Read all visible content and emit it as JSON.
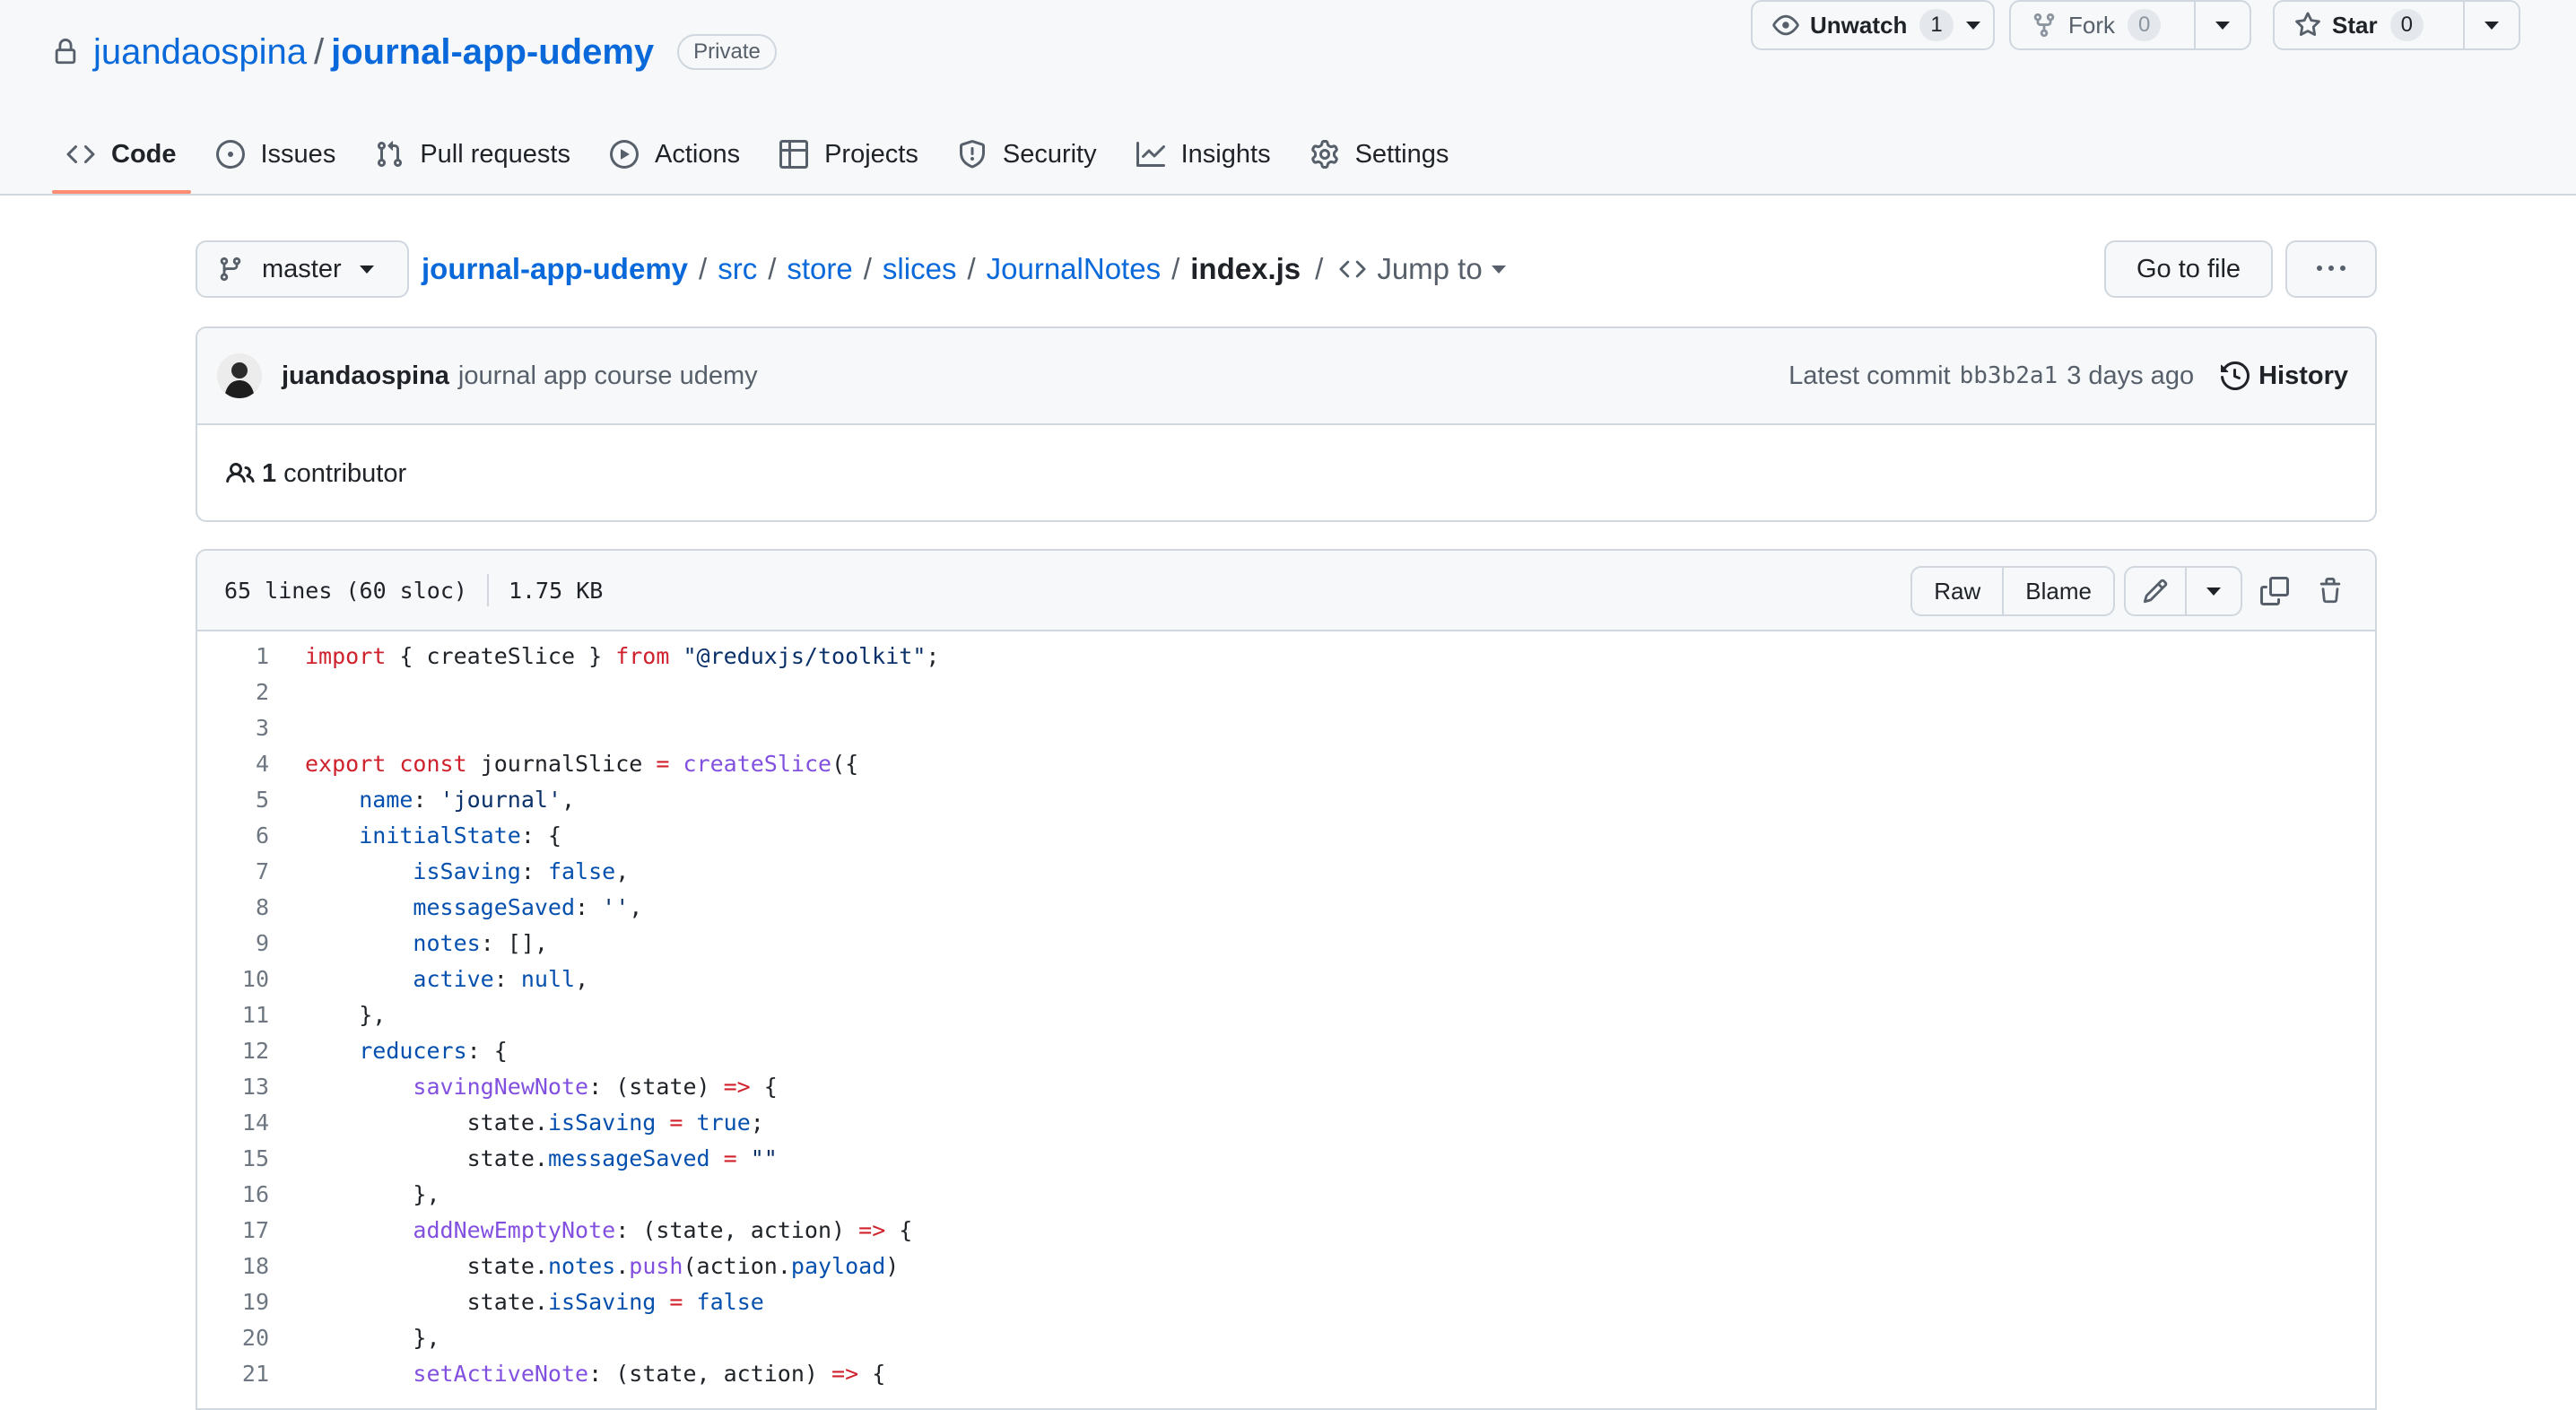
{
  "repo": {
    "owner": "juandaospina",
    "slash": "/",
    "name": "journal-app-udemy",
    "visibility": "Private",
    "unwatch_label": "Unwatch",
    "unwatch_count": "1",
    "fork_label": "Fork",
    "fork_count": "0",
    "star_label": "Star",
    "star_count": "0"
  },
  "tabs": [
    {
      "label": "Code",
      "icon": "code-icon",
      "active": true
    },
    {
      "label": "Issues",
      "icon": "issue-opened-icon"
    },
    {
      "label": "Pull requests",
      "icon": "git-pull-request-icon"
    },
    {
      "label": "Actions",
      "icon": "play-icon"
    },
    {
      "label": "Projects",
      "icon": "table-icon"
    },
    {
      "label": "Security",
      "icon": "shield-icon"
    },
    {
      "label": "Insights",
      "icon": "graph-icon"
    },
    {
      "label": "Settings",
      "icon": "gear-icon"
    }
  ],
  "branch": "master",
  "breadcrumb": {
    "parts": [
      "journal-app-udemy",
      "src",
      "store",
      "slices",
      "JournalNotes"
    ],
    "separator": "/",
    "file": "index.js",
    "jump_to": "Jump to"
  },
  "goto_file": "Go to file",
  "commit": {
    "author": "juandaospina",
    "message": "journal app course udemy",
    "latest_label": "Latest commit",
    "sha": "bb3b2a1",
    "time": "3 days ago",
    "history_label": "History",
    "contributors_count": "1",
    "contributors_label": "contributor"
  },
  "file": {
    "lines_info": "65 lines (60 sloc)",
    "size": "1.75 KB",
    "raw_label": "Raw",
    "blame_label": "Blame"
  },
  "code_lines": [
    "import { createSlice } from \"@reduxjs/toolkit\";",
    "",
    "",
    "export const journalSlice = createSlice({",
    "    name: 'journal',",
    "    initialState: {",
    "        isSaving: false,",
    "        messageSaved: '',",
    "        notes: [],",
    "        active: null,",
    "    },",
    "    reducers: {",
    "        savingNewNote: (state) => {",
    "            state.isSaving = true;",
    "            state.messageSaved = \"\"",
    "        },",
    "        addNewEmptyNote: (state, action) => {",
    "            state.notes.push(action.payload)",
    "            state.isSaving = false",
    "        },",
    "        setActiveNote: (state, action) => {"
  ]
}
